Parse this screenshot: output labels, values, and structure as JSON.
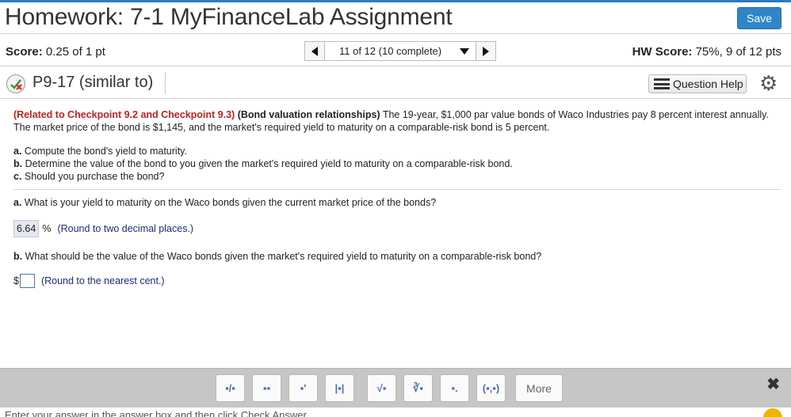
{
  "header": {
    "title": "Homework: 7-1 MyFinanceLab Assignment",
    "save_label": "Save"
  },
  "score": {
    "label": "Score:",
    "value": "0.25 of 1 pt",
    "nav_position": "11 of 12 (10 complete)",
    "hw_label": "HW Score:",
    "hw_value": "75%, 9 of 12 pts"
  },
  "question": {
    "id": "P9-17 (similar to)",
    "help_label": "Question Help"
  },
  "problem": {
    "related": "(Related to Checkpoint 9.2 and Checkpoint 9.3)",
    "topic": "(Bond valuation relationships)",
    "text": "The 19-year, $1,000 par value bonds of Waco Industries pay 8 percent interest annually. The market price of the bond is $1,145, and the market's required yield to maturity on a comparable-risk bond is 5 percent.",
    "parts": [
      {
        "letter": "a.",
        "text": "Compute the bond's yield to maturity."
      },
      {
        "letter": "b.",
        "text": "Determine the value of the bond to you given the market's required yield to maturity on a comparable-risk bond."
      },
      {
        "letter": "c.",
        "text": "Should you purchase the bond?"
      }
    ]
  },
  "qa": [
    {
      "letter": "a.",
      "question": "What is your yield to maturity on the Waco bonds given the current market price of the bonds?",
      "answer": "6.64",
      "unit": "%",
      "hint": "(Round to two decimal places.)"
    },
    {
      "letter": "b.",
      "question": "What should be the value of the Waco bonds given the market's required yield to maturity on a comparable-risk bond?",
      "prefix": "$",
      "hint": "(Round to the nearest cent.)"
    }
  ],
  "toolbar": {
    "more_label": "More",
    "close_label": "✖",
    "tools": [
      "▪/▪",
      "▪▪",
      "▪'",
      "|▪|",
      "√▪",
      "∛▪",
      "▪.",
      "(▪,▪)"
    ]
  },
  "footer": {
    "text": "Enter your answer in the answer box and then click Check Answer."
  }
}
